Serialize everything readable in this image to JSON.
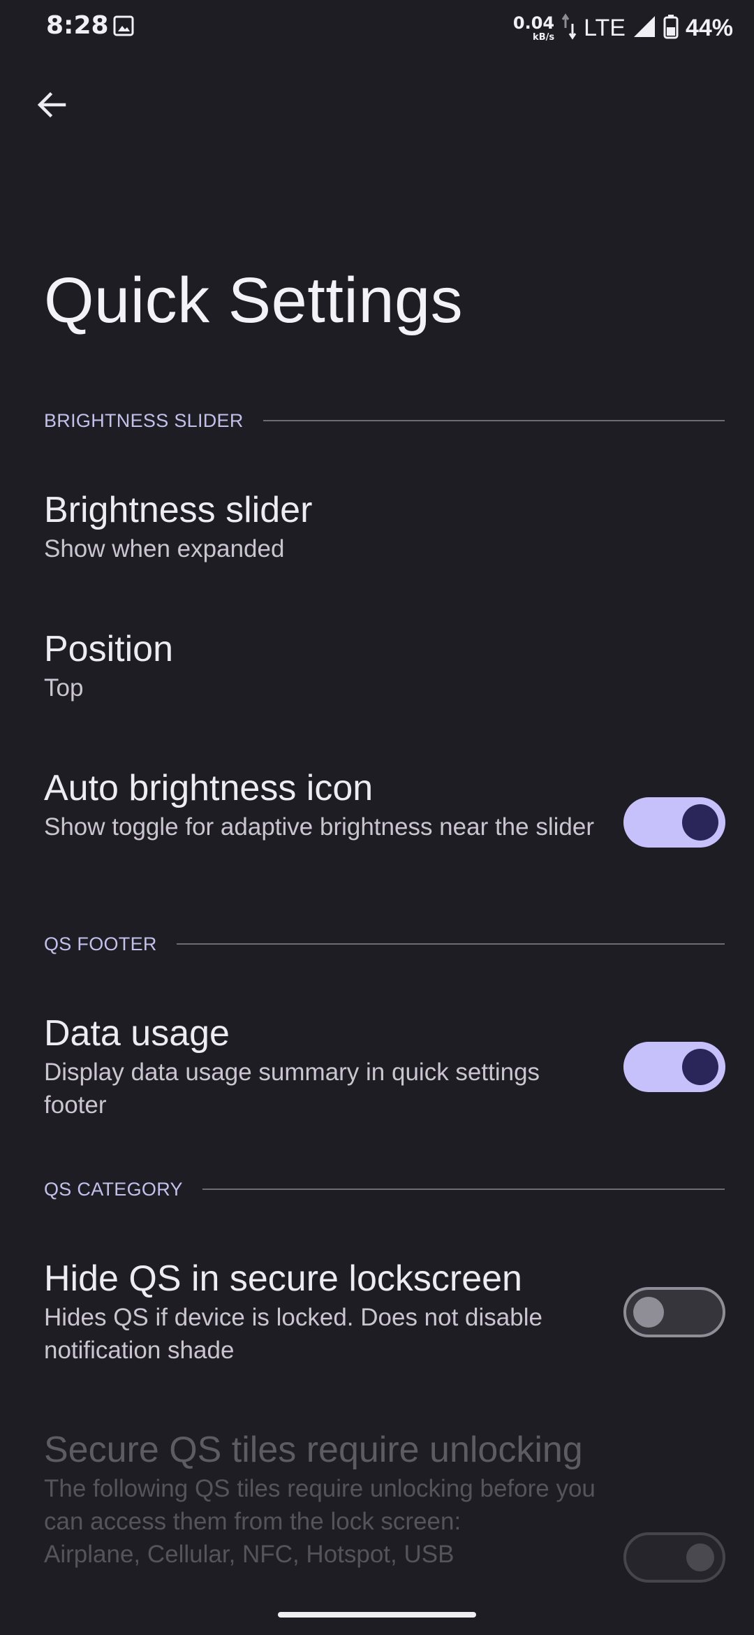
{
  "status_bar": {
    "time": "8:28",
    "net_speed_value": "0.04",
    "net_speed_unit": "kB/s",
    "network_type": "LTE",
    "battery_percent": "44%",
    "icons": [
      "image-notification-icon",
      "data-arrows-icon",
      "signal-icon",
      "battery-icon"
    ]
  },
  "toolbar": {
    "back_icon": "arrow-left-icon"
  },
  "page": {
    "title": "Quick Settings"
  },
  "sections": {
    "brightness": {
      "header": "BRIGHTNESS SLIDER",
      "items": [
        {
          "title": "Brightness slider",
          "summary": "Show when expanded"
        },
        {
          "title": "Position",
          "summary": "Top"
        },
        {
          "title": "Auto brightness icon",
          "summary": "Show toggle for adaptive brightness near the slider",
          "toggle": "on"
        }
      ]
    },
    "footer": {
      "header": "QS FOOTER",
      "items": [
        {
          "title": "Data usage",
          "summary": "Display data usage summary in quick settings footer",
          "toggle": "on"
        }
      ]
    },
    "category": {
      "header": "QS CATEGORY",
      "items": [
        {
          "title": "Hide QS in secure lockscreen",
          "summary": "Hides QS if device is locked. Does not disable notification shade",
          "toggle": "off"
        },
        {
          "title": "Secure QS tiles require unlocking",
          "summary": "The following QS tiles require unlocking before you can access them from the lock screen:",
          "summary_extra": "Airplane, Cellular, NFC, Hotspot, USB",
          "toggle": "off",
          "enabled": false
        }
      ]
    }
  },
  "colors": {
    "background": "#1e1d23",
    "accent": "#c6c0fb",
    "section_label": "#c4c0ec",
    "toggle_knob_on": "#2b2659"
  }
}
